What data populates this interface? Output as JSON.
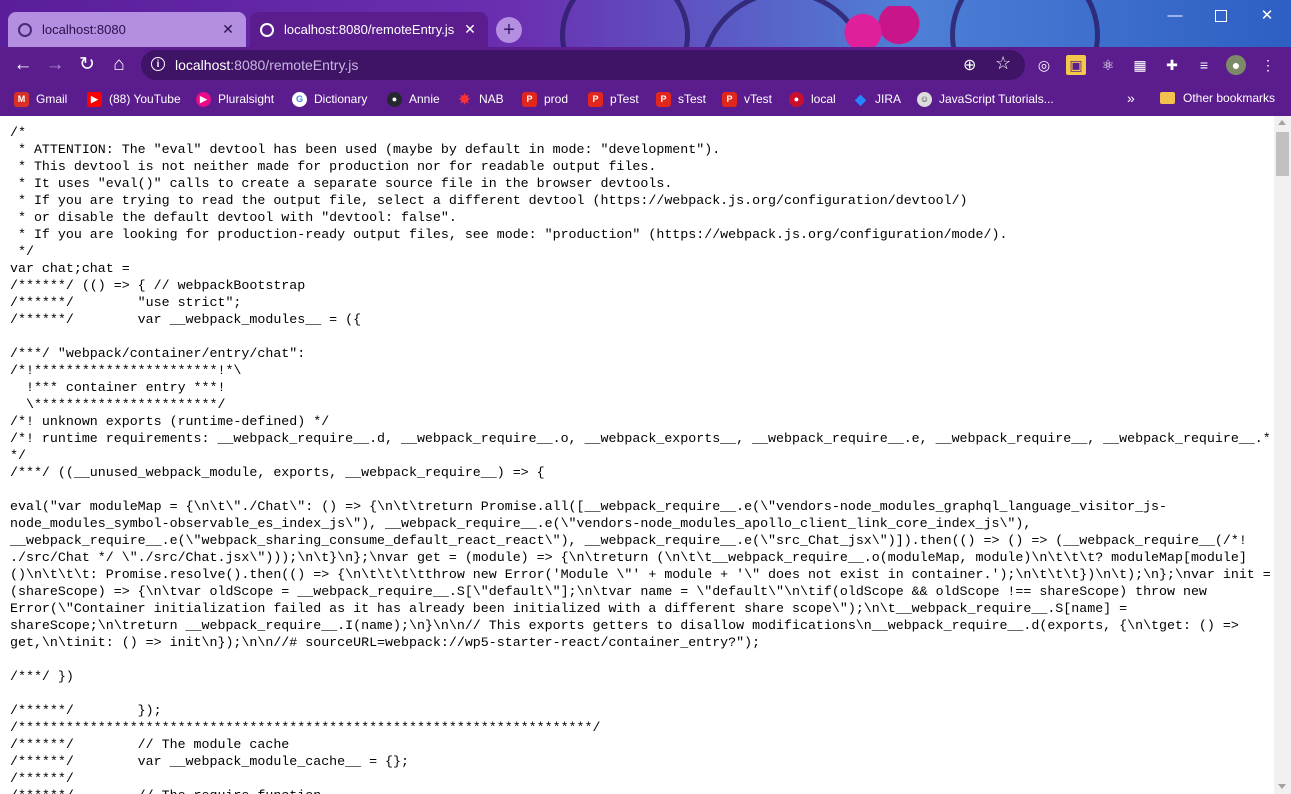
{
  "tabs": [
    {
      "title": "localhost:8080",
      "close": "✕"
    },
    {
      "title": "localhost:8080/remoteEntry.js",
      "close": "✕"
    }
  ],
  "window": {
    "new_tab": "+",
    "minimize": "—",
    "close": "✕"
  },
  "toolbar": {
    "back": "←",
    "forward": "→",
    "reload": "↻",
    "home": "⌂",
    "url_host": "localhost",
    "url_path": ":8080/remoteEntry.js",
    "info": "i",
    "zoom": "⊕",
    "star": "☆",
    "extensions": [
      "◎",
      "▣",
      "⚛",
      "▦",
      "✚",
      "≡",
      "●",
      "⋮"
    ]
  },
  "bookmarks": [
    {
      "label": "Gmail",
      "icon": "gmail-icon",
      "color": "#d93025",
      "glyph": "M"
    },
    {
      "label": "(88) YouTube",
      "icon": "youtube-icon",
      "color": "#ff0000",
      "glyph": "▶"
    },
    {
      "label": "Pluralsight",
      "icon": "pluralsight-icon",
      "color": "#e80a89",
      "glyph": "▶"
    },
    {
      "label": "Dictionary",
      "icon": "google-icon",
      "color": "#4285f4",
      "glyph": "G"
    },
    {
      "label": "Annie",
      "icon": "github-icon",
      "color": "#24292e",
      "glyph": "●"
    },
    {
      "label": "NAB",
      "icon": "nab-icon",
      "color": "#c20000",
      "glyph": "✸"
    },
    {
      "label": "prod",
      "icon": "prod-icon",
      "color": "#e1261c",
      "glyph": "P"
    },
    {
      "label": "pTest",
      "icon": "ptest-icon",
      "color": "#e1261c",
      "glyph": "P"
    },
    {
      "label": "sTest",
      "icon": "stest-icon",
      "color": "#e1261c",
      "glyph": "P"
    },
    {
      "label": "vTest",
      "icon": "vtest-icon",
      "color": "#e1261c",
      "glyph": "P"
    },
    {
      "label": "local",
      "icon": "local-icon",
      "color": "#c8102e",
      "glyph": "●"
    },
    {
      "label": "JIRA",
      "icon": "jira-icon",
      "color": "#2684ff",
      "glyph": "◆"
    },
    {
      "label": "JavaScript Tutorials...",
      "icon": "javascript-icon",
      "color": "#555555",
      "glyph": "☺"
    }
  ],
  "bookmarks_more": "»",
  "other_bookmarks": "Other bookmarks",
  "code": "/*\n * ATTENTION: The \"eval\" devtool has been used (maybe by default in mode: \"development\").\n * This devtool is not neither made for production nor for readable output files.\n * It uses \"eval()\" calls to create a separate source file in the browser devtools.\n * If you are trying to read the output file, select a different devtool (https://webpack.js.org/configuration/devtool/)\n * or disable the default devtool with \"devtool: false\".\n * If you are looking for production-ready output files, see mode: \"production\" (https://webpack.js.org/configuration/mode/).\n */\nvar chat;chat =\n/******/ (() => { // webpackBootstrap\n/******/ \t\"use strict\";\n/******/ \tvar __webpack_modules__ = ({\n\n/***/ \"webpack/container/entry/chat\":\n/*!***********************!*\\\n  !*** container entry ***!\n  \\***********************/\n/*! unknown exports (runtime-defined) */\n/*! runtime requirements: __webpack_require__.d, __webpack_require__.o, __webpack_exports__, __webpack_require__.e, __webpack_require__, __webpack_require__.*\n*/\n/***/ ((__unused_webpack_module, exports, __webpack_require__) => {\n\neval(\"var moduleMap = {\\n\\t\\\"./Chat\\\": () => {\\n\\t\\treturn Promise.all([__webpack_require__.e(\\\"vendors-node_modules_graphql_language_visitor_js-\nnode_modules_symbol-observable_es_index_js\\\"), __webpack_require__.e(\\\"vendors-node_modules_apollo_client_link_core_index_js\\\"),\n__webpack_require__.e(\\\"webpack_sharing_consume_default_react_react\\\"), __webpack_require__.e(\\\"src_Chat_jsx\\\")]).then(() => () => (__webpack_require__(/*!\n./src/Chat */ \\\"./src/Chat.jsx\\\")));\\n\\t}\\n};\\nvar get = (module) => {\\n\\treturn (\\n\\t\\t__webpack_require__.o(moduleMap, module)\\n\\t\\t\\t? moduleMap[module]\n()\\n\\t\\t\\t: Promise.resolve().then(() => {\\n\\t\\t\\t\\tthrow new Error('Module \\\"' + module + '\\\" does not exist in container.');\\n\\t\\t\\t})\\n\\t);\\n};\\nvar init =\n(shareScope) => {\\n\\tvar oldScope = __webpack_require__.S[\\\"default\\\"];\\n\\tvar name = \\\"default\\\"\\n\\tif(oldScope && oldScope !== shareScope) throw new\nError(\\\"Container initialization failed as it has already been initialized with a different share scope\\\");\\n\\t__webpack_require__.S[name] =\nshareScope;\\n\\treturn __webpack_require__.I(name);\\n}\\n\\n// This exports getters to disallow modifications\\n__webpack_require__.d(exports, {\\n\\tget: () =>\nget,\\n\\tinit: () => init\\n});\\n\\n//# sourceURL=webpack://wp5-starter-react/container_entry?\");\n\n/***/ })\n\n/******/ \t});\n/************************************************************************/\n/******/ \t// The module cache\n/******/ \tvar __webpack_module_cache__ = {};\n/******/\n/******/ \t// The require function"
}
